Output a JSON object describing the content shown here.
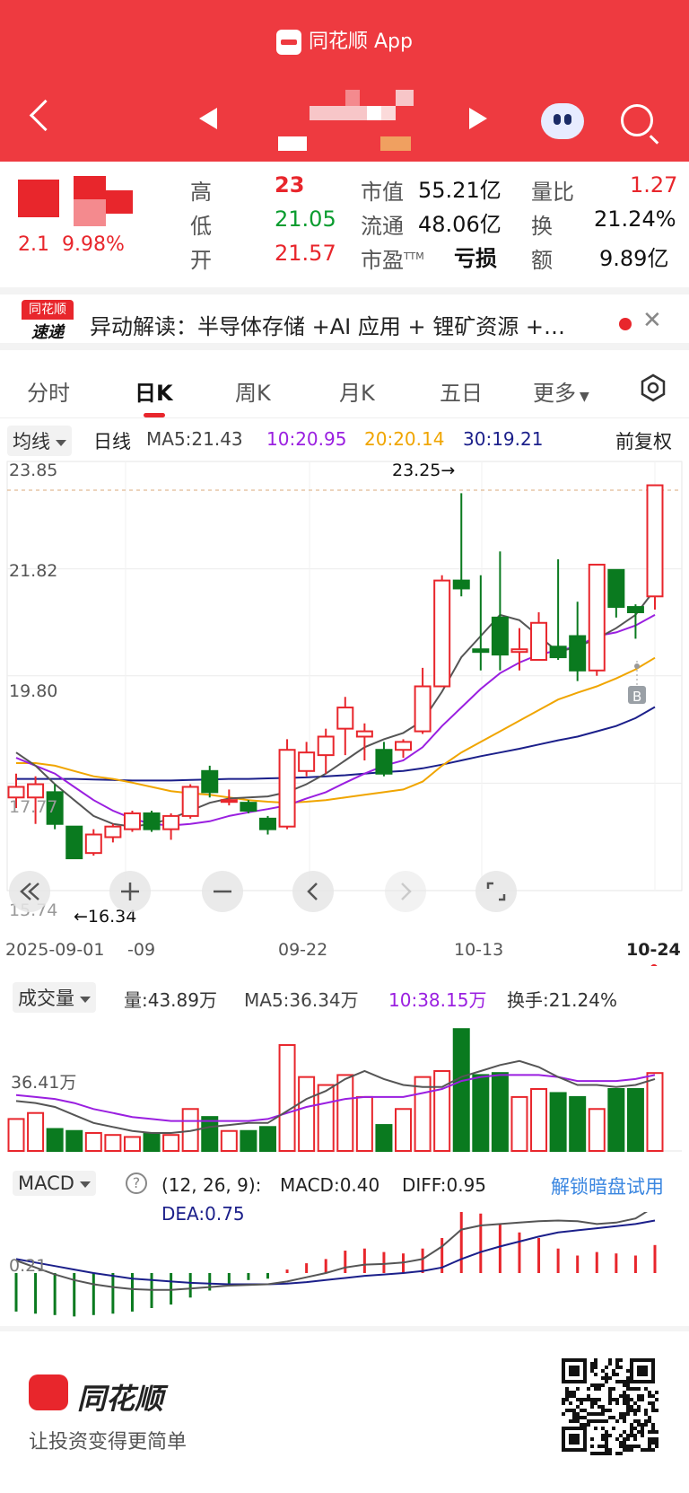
{
  "header": {
    "app_name": "同花顺 App"
  },
  "quote": {
    "change_text": "2.1  9.98%",
    "high_label": "高",
    "high_value": "23",
    "low_label": "低",
    "low_value": "21.05",
    "open_label": "开",
    "open_value": "21.57",
    "market_cap_label": "市值",
    "market_cap_value": "55.21亿",
    "float_cap_label": "流通",
    "float_cap_value": "48.06亿",
    "pe_label": "市盈",
    "pe_sup": "TTM",
    "pe_value": "亏损",
    "volume_ratio_label": "量比",
    "volume_ratio_value": "1.27",
    "turnover_label": "换",
    "turnover_value": "21.24%",
    "amount_label": "额",
    "amount_value": "9.89亿"
  },
  "alert": {
    "logo_top": "同花顺",
    "logo_bottom": "速递",
    "text": "异动解读：半导体存储 +AI 应用 + 锂矿资源 +…"
  },
  "tabs": [
    "分时",
    "日K",
    "周K",
    "月K",
    "五日",
    "更多"
  ],
  "ma_bar": {
    "selector": "均线",
    "period": "日线",
    "ma5": "MA5:21.43",
    "ma10": "10:20.95",
    "ma20": "20:20.14",
    "ma30": "30:19.21",
    "adjust": "前复权"
  },
  "colors": {
    "up": "#e8262c",
    "down": "#0a7a1f",
    "ma5": "#555555",
    "ma10": "#9a1fe0",
    "ma20": "#f0a500",
    "ma30": "#1b1f8a",
    "header": "#ee3a40"
  },
  "kline": {
    "y_labels": [
      "23.85",
      "21.82",
      "19.80",
      "17.77",
      "15.74"
    ],
    "high_marker": "23.25→",
    "low_marker": "←16.34",
    "dates": [
      "2025-09-01",
      "-09",
      "09-22",
      "10-13",
      "10-24"
    ],
    "b_marker": "B"
  },
  "volume": {
    "selector": "成交量",
    "vol": "量:43.89万",
    "ma5": "MA5:36.34万",
    "ma10": "10:38.15万",
    "turnover": "换手:21.24%",
    "y_label": "36.41万"
  },
  "macd": {
    "selector": "MACD",
    "help_icon": "?",
    "params": "(12, 26, 9):",
    "macd": "MACD:0.40",
    "diff": "DIFF:0.95",
    "dea": "DEA:0.75",
    "unlock": "解锁暗盘试用",
    "y_label": "0.21"
  },
  "chart_data": {
    "type": "candlestick",
    "ylim": [
      15.74,
      23.85
    ],
    "candles": [
      {
        "o": 17.5,
        "c": 17.7,
        "h": 17.95,
        "l": 17.3
      },
      {
        "o": 17.5,
        "c": 17.75,
        "h": 17.9,
        "l": 17.0
      },
      {
        "o": 17.6,
        "c": 17.0,
        "h": 17.75,
        "l": 16.9
      },
      {
        "o": 16.95,
        "c": 16.35,
        "h": 16.95,
        "l": 16.34
      },
      {
        "o": 16.45,
        "c": 16.8,
        "h": 16.9,
        "l": 16.4
      },
      {
        "o": 16.75,
        "c": 16.95,
        "h": 17.0,
        "l": 16.65
      },
      {
        "o": 16.9,
        "c": 17.2,
        "h": 17.25,
        "l": 16.85
      },
      {
        "o": 17.2,
        "c": 16.9,
        "h": 17.25,
        "l": 16.85
      },
      {
        "o": 16.9,
        "c": 17.15,
        "h": 17.2,
        "l": 16.7
      },
      {
        "o": 17.15,
        "c": 17.7,
        "h": 17.75,
        "l": 17.1
      },
      {
        "o": 18.0,
        "c": 17.6,
        "h": 18.1,
        "l": 17.5
      },
      {
        "o": 17.45,
        "c": 17.45,
        "h": 17.65,
        "l": 17.35
      },
      {
        "o": 17.4,
        "c": 17.25,
        "h": 17.45,
        "l": 17.2
      },
      {
        "o": 17.1,
        "c": 16.9,
        "h": 17.15,
        "l": 16.8
      },
      {
        "o": 16.95,
        "c": 18.4,
        "h": 18.6,
        "l": 16.9
      },
      {
        "o": 18.0,
        "c": 18.35,
        "h": 18.55,
        "l": 17.9
      },
      {
        "o": 18.3,
        "c": 18.65,
        "h": 18.8,
        "l": 17.95
      },
      {
        "o": 18.8,
        "c": 19.2,
        "h": 19.4,
        "l": 18.3
      },
      {
        "o": 18.65,
        "c": 18.75,
        "h": 18.9,
        "l": 18.2
      },
      {
        "o": 18.4,
        "c": 17.95,
        "h": 18.55,
        "l": 17.9
      },
      {
        "o": 18.4,
        "c": 18.55,
        "h": 18.6,
        "l": 18.25
      },
      {
        "o": 18.75,
        "c": 19.6,
        "h": 19.95,
        "l": 18.7
      },
      {
        "o": 19.6,
        "c": 21.6,
        "h": 21.7,
        "l": 19.6
      },
      {
        "o": 21.6,
        "c": 21.45,
        "h": 23.25,
        "l": 21.3
      },
      {
        "o": 20.3,
        "c": 20.25,
        "h": 21.7,
        "l": 19.9
      },
      {
        "o": 20.9,
        "c": 20.2,
        "h": 22.15,
        "l": 19.9
      },
      {
        "o": 20.25,
        "c": 20.3,
        "h": 20.7,
        "l": 19.9
      },
      {
        "o": 20.1,
        "c": 20.8,
        "h": 21.0,
        "l": 20.1
      },
      {
        "o": 20.35,
        "c": 20.15,
        "h": 22.0,
        "l": 20.1
      },
      {
        "o": 20.55,
        "c": 19.9,
        "h": 21.2,
        "l": 19.7
      },
      {
        "o": 19.9,
        "c": 21.9,
        "h": 21.9,
        "l": 19.8
      },
      {
        "o": 21.8,
        "c": 21.1,
        "h": 21.8,
        "l": 20.9
      },
      {
        "o": 21.1,
        "c": 21.0,
        "h": 21.15,
        "l": 20.5
      },
      {
        "o": 21.3,
        "c": 23.4,
        "h": 23.4,
        "l": 21.05
      }
    ],
    "ma5": [
      18.35,
      18.1,
      17.75,
      17.45,
      17.15,
      17.0,
      16.95,
      17.0,
      17.1,
      17.25,
      17.4,
      17.48,
      17.5,
      17.52,
      17.6,
      17.75,
      17.95,
      18.2,
      18.45,
      18.6,
      18.72,
      18.95,
      19.5,
      20.15,
      20.55,
      20.95,
      20.85,
      20.55,
      20.25,
      20.35,
      20.5,
      20.7,
      20.95,
      21.43
    ],
    "ma10": [
      18.25,
      18.1,
      17.95,
      17.7,
      17.45,
      17.25,
      17.1,
      17.0,
      16.97,
      17.0,
      17.05,
      17.15,
      17.22,
      17.28,
      17.35,
      17.48,
      17.6,
      17.78,
      17.95,
      18.1,
      18.2,
      18.45,
      18.85,
      19.2,
      19.55,
      19.85,
      20.05,
      20.2,
      20.28,
      20.35,
      20.55,
      20.62,
      20.75,
      20.95
    ],
    "ma20": [
      18.15,
      18.15,
      18.1,
      18.0,
      17.9,
      17.85,
      17.78,
      17.7,
      17.62,
      17.58,
      17.55,
      17.5,
      17.45,
      17.42,
      17.4,
      17.42,
      17.45,
      17.5,
      17.55,
      17.6,
      17.65,
      17.8,
      18.1,
      18.35,
      18.55,
      18.75,
      18.95,
      19.15,
      19.35,
      19.48,
      19.6,
      19.75,
      19.92,
      20.14
    ],
    "ma30": [
      17.85,
      17.85,
      17.85,
      17.85,
      17.84,
      17.83,
      17.82,
      17.82,
      17.82,
      17.83,
      17.84,
      17.85,
      17.85,
      17.86,
      17.87,
      17.88,
      17.9,
      17.92,
      17.95,
      17.98,
      18.0,
      18.05,
      18.12,
      18.2,
      18.28,
      18.35,
      18.42,
      18.5,
      18.58,
      18.65,
      18.75,
      18.85,
      19.0,
      19.21
    ],
    "volume": {
      "values": [
        16,
        19,
        11,
        10,
        9,
        8,
        7,
        9,
        8,
        21,
        17,
        10,
        10,
        12,
        53,
        37,
        33,
        38,
        27,
        13,
        21,
        37,
        40,
        61,
        38,
        39,
        27,
        31,
        29,
        27,
        21,
        31,
        31,
        39
      ],
      "ma5": [
        25,
        24,
        22,
        18,
        14,
        12,
        10,
        9,
        9,
        10,
        12,
        13,
        14,
        14,
        20,
        26,
        30,
        36,
        40,
        36,
        33,
        32,
        32,
        37,
        40,
        43,
        45,
        42,
        37,
        33,
        33,
        32,
        33,
        36
      ],
      "ma10": [
        28,
        27,
        26,
        24,
        21,
        19,
        17,
        16,
        15,
        15,
        15,
        15,
        15,
        16,
        19,
        22,
        24,
        26,
        27,
        27,
        27,
        29,
        31,
        35,
        37,
        38,
        38,
        38,
        37,
        35,
        35,
        35,
        36,
        38
      ],
      "ylabel_value": "36.41万"
    },
    "macd": {
      "hist": [
        -0.55,
        -0.58,
        -0.6,
        -0.62,
        -0.6,
        -0.58,
        -0.55,
        -0.5,
        -0.45,
        -0.35,
        -0.25,
        -0.15,
        -0.1,
        -0.08,
        0.05,
        0.14,
        0.2,
        0.32,
        0.35,
        0.3,
        0.28,
        0.35,
        0.5,
        0.95,
        0.85,
        0.7,
        0.58,
        0.5,
        0.35,
        0.25,
        0.3,
        0.28,
        0.25,
        0.4
      ],
      "diff": [
        0.18,
        0.08,
        -0.02,
        -0.1,
        -0.16,
        -0.2,
        -0.23,
        -0.24,
        -0.24,
        -0.22,
        -0.2,
        -0.18,
        -0.17,
        -0.16,
        -0.12,
        -0.06,
        0.0,
        0.08,
        0.12,
        0.13,
        0.15,
        0.2,
        0.38,
        0.62,
        0.68,
        0.7,
        0.72,
        0.74,
        0.75,
        0.74,
        0.7,
        0.72,
        0.78,
        0.95
      ],
      "dea": [
        0.2,
        0.15,
        0.1,
        0.05,
        0.0,
        -0.04,
        -0.08,
        -0.1,
        -0.12,
        -0.14,
        -0.15,
        -0.16,
        -0.16,
        -0.16,
        -0.15,
        -0.13,
        -0.1,
        -0.07,
        -0.04,
        -0.02,
        0.0,
        0.03,
        0.08,
        0.2,
        0.3,
        0.38,
        0.45,
        0.52,
        0.58,
        0.61,
        0.64,
        0.67,
        0.7,
        0.75
      ]
    }
  },
  "footer": {
    "brand": "同花顺",
    "slogan": "让投资变得更简单"
  }
}
